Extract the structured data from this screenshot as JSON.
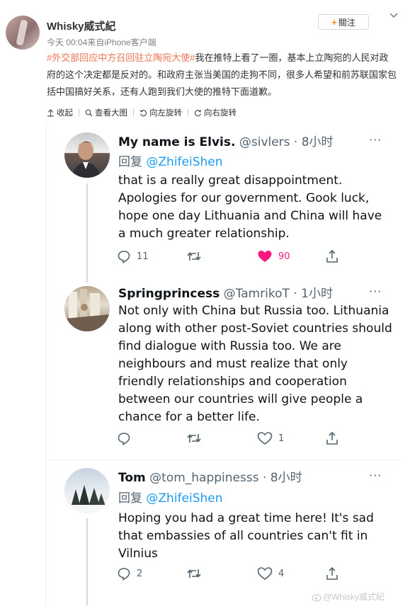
{
  "post": {
    "username": "Whisky威式紀",
    "meta": "今天 00:04来自iPhone客户端",
    "follow_label": "關注",
    "hashtag": "#外交部回应中方召回驻立陶宛大使#",
    "text": "我在推特上看了一圈，基本上立陶宛的人民对政府的这个决定都是反对的。和政府主张当美国的走狗不同，很多人希望和前苏联国家包括中国搞好关系，还有人跑到我们大使的推特下面道歉。"
  },
  "actions": {
    "collapse": "收起",
    "view_large": "查看大图",
    "rotate_left": "向左旋转",
    "rotate_right": "向右旋转"
  },
  "tweets": [
    {
      "name": "My name is Elvis.",
      "handle": "@sivlers · 8小时",
      "reply_prefix": "回复",
      "reply_to": "@ZhifeiShen",
      "body": "that is a really great disappointment. Apologies for our government. Gook luck, hope one day Lithuania and China will have a much greater relationship.",
      "replies": "11",
      "retweets": "",
      "likes": "90",
      "liked": true
    },
    {
      "name": "Springprincess",
      "handle": "@TamrikoT · 1小时",
      "body": "Not only with China but Russia too. Lithuania along with other post-Soviet countries should find dialogue with Russia too. We are neighbours and must realize that only friendly relationships and cooperation between our countries will give people a chance for a better life.",
      "replies": "",
      "retweets": "",
      "likes": "1",
      "liked": false
    },
    {
      "name": "Tom",
      "handle": "@tom_happinesss · 8小时",
      "reply_prefix": "回复",
      "reply_to": "@ZhifeiShen",
      "body": "Hoping you had a great time here! It's sad that embassies of all countries can't fit in Vilnius",
      "replies": "2",
      "retweets": "",
      "likes": "4",
      "liked": false
    }
  ],
  "more_label": "···",
  "watermark": "@Whisky威式紀",
  "colors": {
    "hashtag": "#eb7350",
    "twitter_blue": "#1d9bf0",
    "like_red": "#f91880",
    "follow_plus": "#ff8200"
  }
}
